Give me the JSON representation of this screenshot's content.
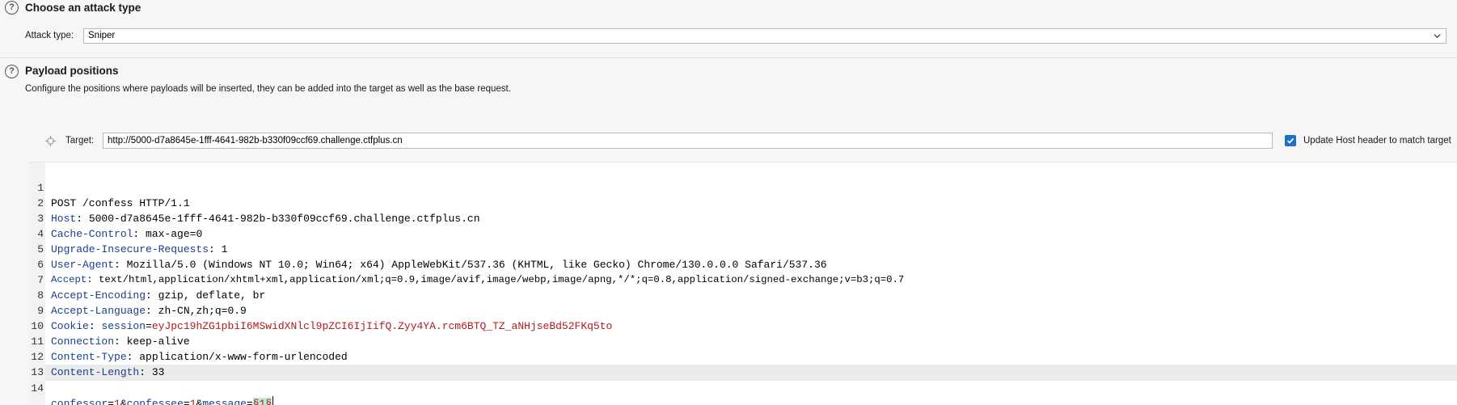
{
  "attack_type_section": {
    "title": "Choose an attack type",
    "label": "Attack type:",
    "selected": "Sniper"
  },
  "payload_section": {
    "title": "Payload positions",
    "description": "Configure the positions where payloads will be inserted, they can be added into the target as well as the base request."
  },
  "target": {
    "label": "Target:",
    "value": "http://5000-d7a8645e-1fff-4641-982b-b330f09ccf69.challenge.ctfplus.cn",
    "update_host_label": "Update Host header to match target",
    "update_host_checked": true
  },
  "request": {
    "lines": [
      {
        "n": "1",
        "name": "",
        "sep": "",
        "value": "POST /confess HTTP/1.1"
      },
      {
        "n": "2",
        "name": "Host",
        "sep": ": ",
        "value": "5000-d7a8645e-1fff-4641-982b-b330f09ccf69.challenge.ctfplus.cn"
      },
      {
        "n": "3",
        "name": "Cache-Control",
        "sep": ": ",
        "value": "max-age=0"
      },
      {
        "n": "4",
        "name": "Upgrade-Insecure-Requests",
        "sep": ": ",
        "value": "1"
      },
      {
        "n": "5",
        "name": "User-Agent",
        "sep": ": ",
        "value": "Mozilla/5.0 (Windows NT 10.0; Win64; x64) AppleWebKit/537.36 (KHTML, like Gecko) Chrome/130.0.0.0 Safari/537.36"
      },
      {
        "n": "6",
        "name": "Accept",
        "sep": ": ",
        "value": "text/html,application/xhtml+xml,application/xml;q=0.9,image/avif,image/webp,image/apng,*/*;q=0.8,application/signed-exchange;v=b3;q=0.7"
      },
      {
        "n": "7",
        "name": "Accept-Encoding",
        "sep": ": ",
        "value": "gzip, deflate, br"
      },
      {
        "n": "8",
        "name": "Accept-Language",
        "sep": ": ",
        "value": "zh-CN,zh;q=0.9"
      },
      {
        "n": "9",
        "name": "Cookie",
        "sep": ": ",
        "cookie_name": "session",
        "cookie_value": "eyJpc19hZG1pbiI6MSwidXNlcl9pZCI6IjIifQ.Zyy4YA.rcm6BTQ_TZ_aNHjseBd52FKq5to"
      },
      {
        "n": "10",
        "name": "Connection",
        "sep": ": ",
        "value": "keep-alive"
      },
      {
        "n": "11",
        "name": "Content-Type",
        "sep": ": ",
        "value": "application/x-www-form-urlencoded"
      },
      {
        "n": "12",
        "name": "Content-Length",
        "sep": ": ",
        "value": "33"
      },
      {
        "n": "13",
        "name": "",
        "sep": "",
        "value": ""
      }
    ],
    "body": {
      "n": "14",
      "p1_name": "confessor",
      "p1_value": "1",
      "p2_name": "confessee",
      "p2_value": "1",
      "p3_name": "message",
      "marker_open": "§",
      "payload": "1",
      "marker_close": "§"
    }
  },
  "colors": {
    "header_name": "#1a3f8c",
    "cookie": "#b31b1b",
    "payload_marker_bg": "#bfe9d6",
    "checkbox": "#1f6fc6"
  }
}
